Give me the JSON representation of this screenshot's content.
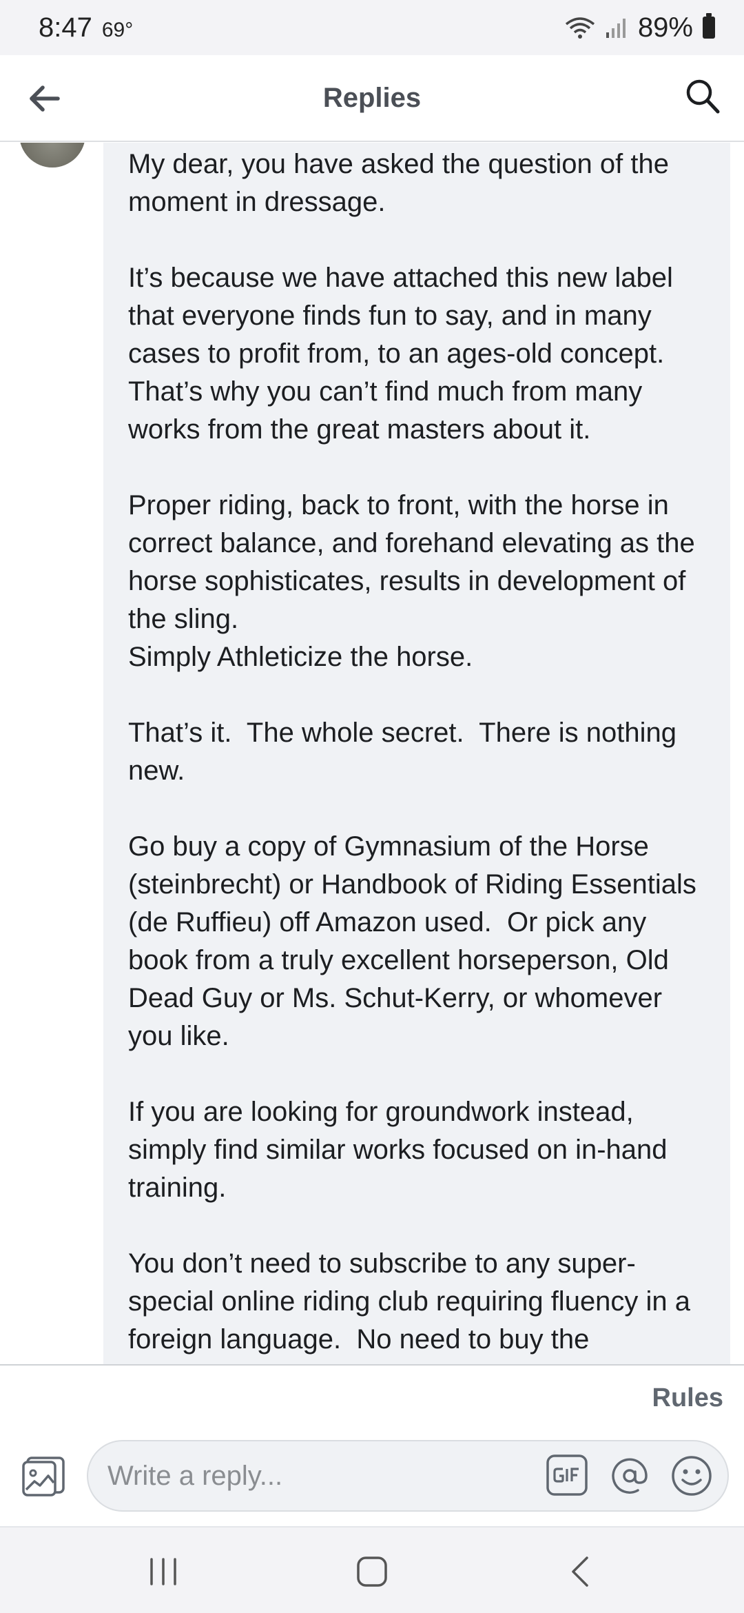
{
  "status_bar": {
    "time": "8:47",
    "temperature": "69°",
    "battery": "89%"
  },
  "header": {
    "title": "Replies"
  },
  "comment": {
    "text": "My dear, you have asked the question of the moment in dressage.\n\nIt’s because we have attached this new label that everyone finds fun to say, and in many cases to profit from, to an ages-old concept. That’s why you can’t find much from many works from the great masters about it.\n\nProper riding, back to front, with the horse in correct balance, and forehand elevating as the horse sophisticates, results in development of the sling.\nSimply Athleticize the horse.\n\nThat’s it.  The whole secret.  There is nothing new.\n\nGo buy a copy of Gymnasium of the Horse (steinbrecht) or Handbook of Riding Essentials (de Ruffieu) off Amazon used.  Or pick any book from a truly excellent horseperson, Old Dead Guy or Ms. Schut-Kerry, or whomever you like.\n\nIf you are looking for groundwork instead, simply find similar works focused on in-hand training.\n\nYou don’t need to subscribe to any super-special online riding club requiring fluency in a foreign language.  No need to buy the"
  },
  "rules": {
    "label": "Rules"
  },
  "composer": {
    "placeholder": "Write a reply...",
    "icons": [
      "photo-icon",
      "gif-icon",
      "mention-icon",
      "emoji-icon"
    ]
  },
  "nav_bar": {
    "icons": [
      "recent-apps-icon",
      "home-icon",
      "back-icon"
    ]
  }
}
